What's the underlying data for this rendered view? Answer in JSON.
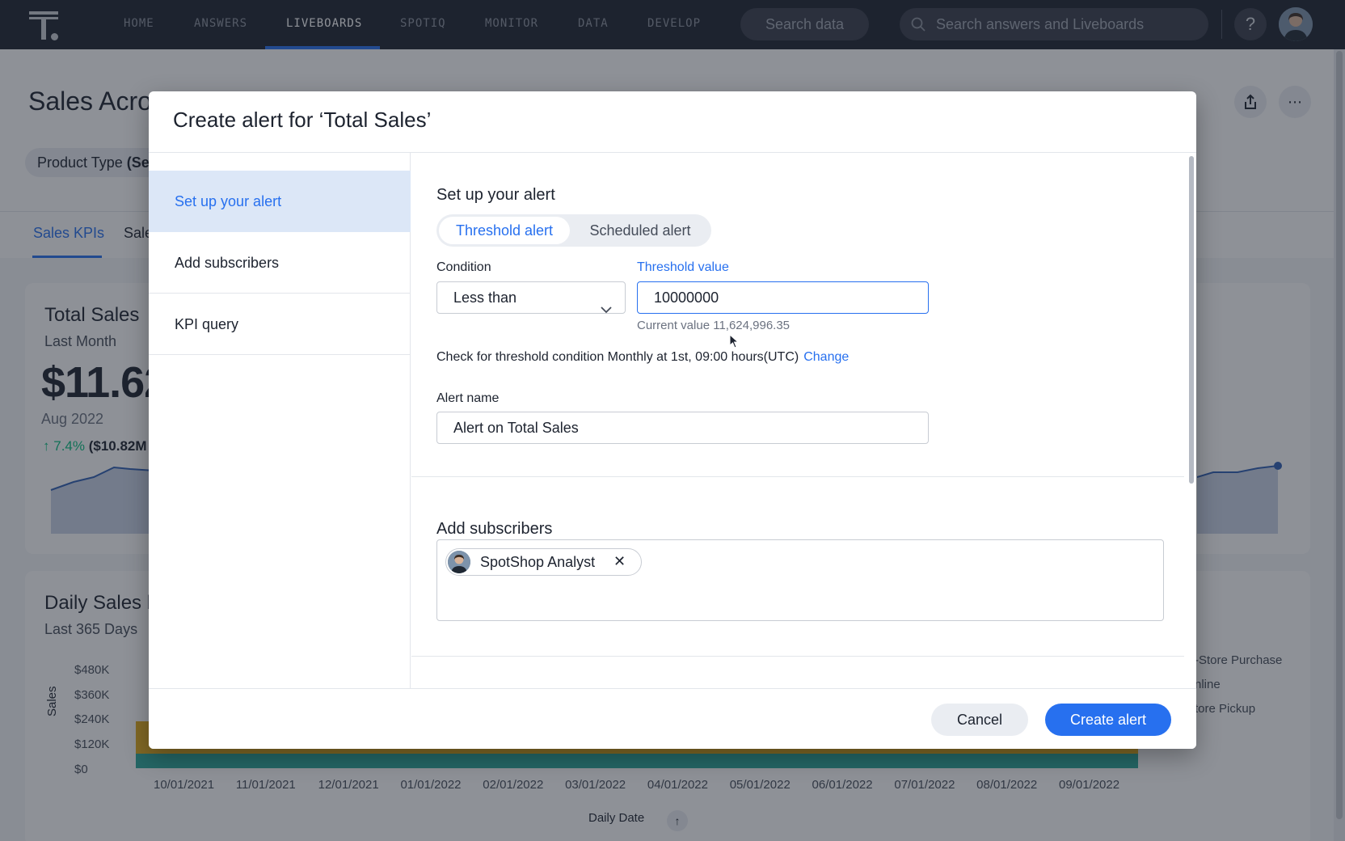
{
  "topnav": {
    "items": [
      "HOME",
      "ANSWERS",
      "LIVEBOARDS",
      "SPOTIQ",
      "MONITOR",
      "DATA",
      "DEVELOP"
    ],
    "active": "LIVEBOARDS",
    "search_data_label": "Search data",
    "search_answers_placeholder": "Search answers and Liveboards",
    "help_label": "?"
  },
  "page": {
    "title": "Sales Acro",
    "filter_label": "Product Type",
    "filter_value": "(Se",
    "tabs": [
      "Sales KPIs",
      "Sale"
    ],
    "kpi_card": {
      "title": "Total Sales",
      "subtitle": "Last Month",
      "value": "$11.62",
      "date": "Aug 2022",
      "change_pct": "7.4%",
      "change_abs": "($10.82M"
    },
    "daily_card": {
      "title": "Daily Sales b",
      "subtitle": "Last 365 Days"
    }
  },
  "chart_data": {
    "type": "area",
    "ylabel": "Sales",
    "xlabel": "Daily Date",
    "y_ticks": [
      "$480K",
      "$360K",
      "$240K",
      "$120K",
      "$0"
    ],
    "x_ticks": [
      "10/01/2021",
      "11/01/2021",
      "12/01/2021",
      "01/01/2022",
      "02/01/2022",
      "03/01/2022",
      "04/01/2022",
      "05/01/2022",
      "06/01/2022",
      "07/01/2022",
      "08/01/2022",
      "09/01/2022"
    ],
    "legend": [
      "-Store Purchase",
      "nline",
      "tore Pickup"
    ],
    "colors": [
      "#e3ad1a",
      "#2aa89a"
    ]
  },
  "modal": {
    "title": "Create alert for ‘Total Sales’",
    "side_items": [
      "Set up your alert",
      "Add subscribers",
      "KPI query"
    ],
    "setup": {
      "title": "Set up your alert",
      "toggle_threshold": "Threshold alert",
      "toggle_scheduled": "Scheduled alert",
      "condition_label": "Condition",
      "condition_value": "Less than",
      "threshold_label": "Threshold value",
      "threshold_value": "10000000",
      "current_value": "Current value 11,624,996.35",
      "check_text": "Check for threshold condition Monthly at 1st, 09:00 hours(UTC)",
      "change_link": "Change",
      "alert_name_label": "Alert name",
      "alert_name_value": "Alert on Total Sales"
    },
    "subscribers": {
      "title": "Add subscribers",
      "chip_name": "SpotShop Analyst",
      "chip_close": "✕"
    },
    "footer": {
      "cancel": "Cancel",
      "create": "Create alert"
    }
  }
}
